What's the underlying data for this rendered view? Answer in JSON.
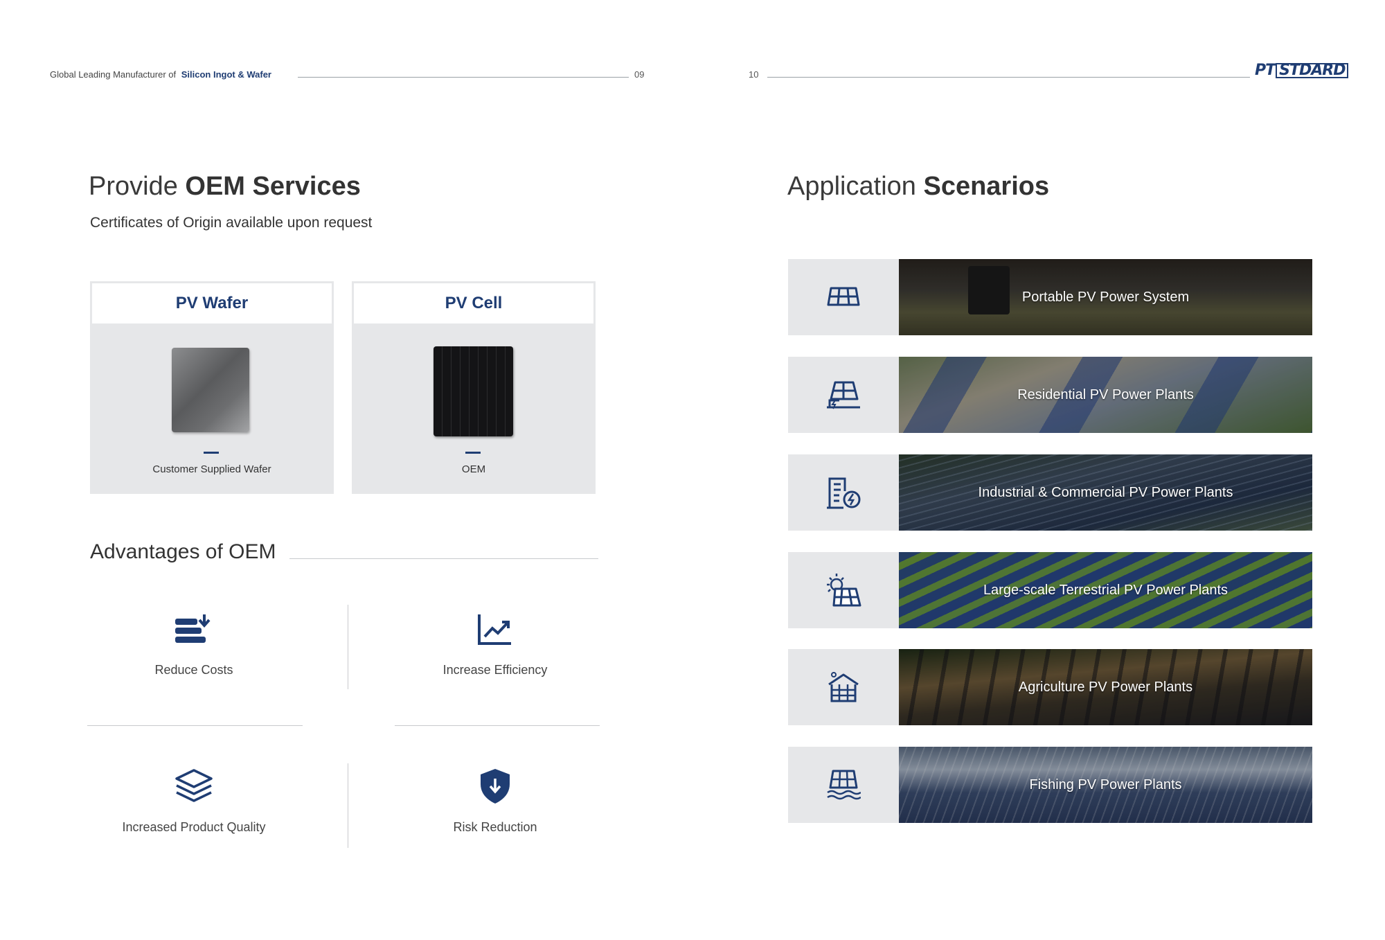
{
  "header": {
    "left_prefix": "Global Leading Manufacturer of",
    "left_emphasis": "Silicon Ingot & Wafer",
    "page_left": "09",
    "page_right": "10",
    "logo": "PTSTDARD"
  },
  "oem": {
    "title_light": "Provide",
    "title_bold": "OEM Services",
    "subtitle": "Certificates of Origin available upon request",
    "cards": [
      {
        "title": "PV Wafer",
        "caption": "Customer Supplied Wafer"
      },
      {
        "title": "PV Cell",
        "caption": "OEM"
      }
    ]
  },
  "advantages": {
    "title": "Advantages of OEM",
    "items": [
      {
        "label": "Reduce Costs",
        "icon": "reduce-costs-icon"
      },
      {
        "label": "Increase Efficiency",
        "icon": "growth-chart-icon"
      },
      {
        "label": "Increased Product Quality",
        "icon": "layers-icon"
      },
      {
        "label": "Risk Reduction",
        "icon": "shield-icon"
      }
    ]
  },
  "scenarios": {
    "title_light": "Application",
    "title_bold": "Scenarios",
    "items": [
      {
        "label": "Portable PV Power System",
        "icon": "solar-panel-icon"
      },
      {
        "label": "Residential PV Power Plants",
        "icon": "rooftop-solar-icon"
      },
      {
        "label": "Industrial & Commercial PV Power Plants",
        "icon": "building-energy-icon"
      },
      {
        "label": "Large-scale Terrestrial PV Power Plants",
        "icon": "sun-panel-icon"
      },
      {
        "label": "Agriculture PV Power Plants",
        "icon": "greenhouse-solar-icon"
      },
      {
        "label": "Fishing PV Power Plants",
        "icon": "water-solar-icon"
      }
    ]
  },
  "colors": {
    "brand": "#1f3d73",
    "panel": "#e6e7e9",
    "text": "#333333"
  }
}
